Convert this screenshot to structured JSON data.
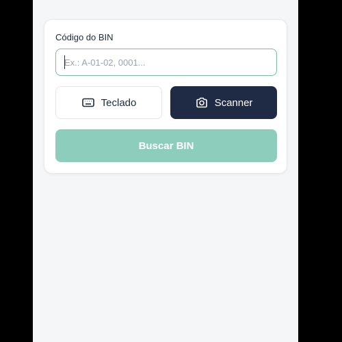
{
  "bin_form": {
    "label": "Código do BIN",
    "input_value": "",
    "input_placeholder": "Ex.: A-01-02, 0001...",
    "keyboard_button_label": "Teclado",
    "keyboard_icon": "keyboard-icon",
    "scanner_button_label": "Scanner",
    "scanner_icon": "camera-icon",
    "search_button_label": "Buscar BIN"
  },
  "colors": {
    "accent": "#7ab9a8",
    "scanner_button_bg": "#1f2a44",
    "search_button_bg": "#8ccdbb"
  }
}
